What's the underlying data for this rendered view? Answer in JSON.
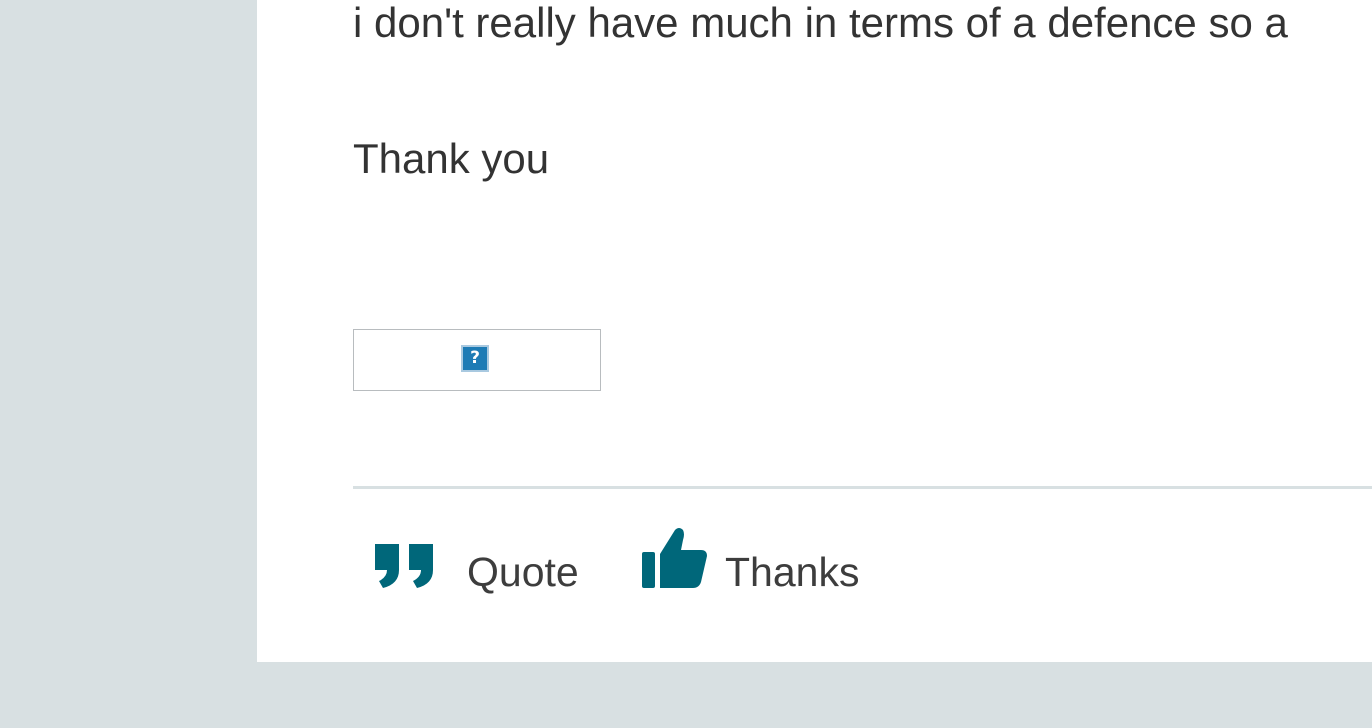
{
  "post": {
    "lines": [
      "i don't really have much in terms of a defence so a",
      "Thank you"
    ],
    "broken_image_glyph": "?"
  },
  "actions": {
    "quote_label": "Quote",
    "quote_icon": "quote-icon",
    "thanks_label": "Thanks",
    "thanks_icon": "thumbs-up-icon"
  },
  "colors": {
    "accent": "#00677a",
    "sidebar_bg": "#d8e0e2",
    "content_bg": "#ffffff",
    "text": "#333333",
    "broken_image_blue": "#1d7bb5"
  }
}
